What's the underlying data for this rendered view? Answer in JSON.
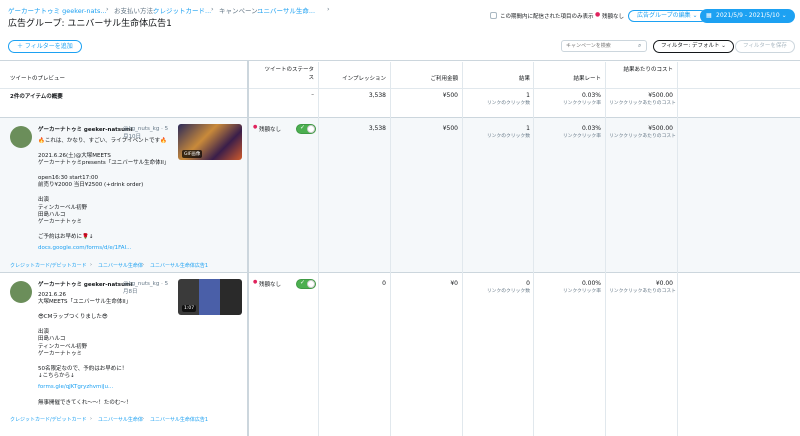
{
  "breadcrumb": {
    "account": "ゲーカーナトゥミ geeker-nats...",
    "payment_label": "お支払い方法:",
    "payment_value": "クレジットカード...",
    "campaign_label": "キャンペーン:",
    "campaign_value": "ユニバーサル生命...",
    "sep": "›"
  },
  "page_title": "広告グループ: ユニバーサル生命体広告1",
  "top_controls": {
    "period_checkbox_label": "この期間内に配信された項目のみ表示",
    "status_label": "残額なし",
    "edit_button": "広告グループの編集 ⌄",
    "date_range": "2021/5/9 - 2021/5/10 ⌄"
  },
  "toolbar": {
    "add_filter": "＋ フィルターを追加",
    "search_placeholder": "キャンペーンを検索",
    "filter_default": "フィルター: デフォルト ⌄",
    "save_filter": "フィルターを保存"
  },
  "columns": {
    "preview": "ツイートのプレビュー",
    "status": "ツイートのステータス",
    "impressions": "インプレッション",
    "spend": "ご利用金額",
    "results": "結果",
    "result_rate": "結果レート",
    "cost_per_result": "結果あたりのコスト"
  },
  "summary": {
    "label": "2件のアイテムの概要",
    "status": "–",
    "impressions": "3,538",
    "spend": "¥500",
    "results": "1",
    "results_sub": "リンクのクリック数",
    "rate": "0.03%",
    "rate_sub": "リンククリック率",
    "cost": "¥500.00",
    "cost_sub": "リンククリックあたりのコスト"
  },
  "rows": [
    {
      "author": "ゲーカーナトゥミ geeker-natsumi",
      "handle": "@kg_nuts_kg · 5月10日",
      "text": "🔥これは、かなり、すごい、ライブイベントです🔥\n\n2021.6.26(土)@大塚MEETS\nゲーカーナトゥミpresents「ユニバーサル生命体II」\n\nopen16:30 start17:00\n前売り¥2000 当日¥2500 (+drink order)\n\n出演\nティンカーベル初野\n田島ハルコ\nゲーカーナトゥミ\n\nご予約はお早めに🌹↓",
      "link": "docs.google.com/forms/d/e/1FAI...",
      "media_badge": "GIF画像",
      "path": [
        "クレジットカード/デビットカード",
        "ユニバーサル生命体",
        "ユニバーサル生命体広告1"
      ],
      "status": "残額なし",
      "impressions": "3,538",
      "spend": "¥500",
      "results": "1",
      "results_sub": "リンクのクリック数",
      "rate": "0.03%",
      "rate_sub": "リンククリック率",
      "cost": "¥500.00",
      "cost_sub": "リンククリックあたりのコスト"
    },
    {
      "author": "ゲーカーナトゥミ geeker-natsumi",
      "handle": "@kg_nuts_kg · 5月8日",
      "text": "2021.6.26\n大塚MEETS「ユニバーサル生命体II」\n\n😎CMラップつくりました😎\n\n出演\n田島ハルコ\nティンカーベル初野\nゲーカーナトゥミ\n\n50名限定なので、予約はお早めに！\n↓こちらから↓",
      "link": "forms.gle/qJKTgryzhvmiJu...",
      "text_after": "\n無事開催できてくれ〜〜！たのむ〜！",
      "media_badge": "1:07",
      "path": [
        "クレジットカード/デビットカード",
        "ユニバーサル生命体",
        "ユニバーサル生命体広告1"
      ],
      "status": "残額なし",
      "impressions": "0",
      "spend": "¥0",
      "results": "0",
      "results_sub": "リンクのクリック数",
      "rate": "0.00%",
      "rate_sub": "リンククリック率",
      "cost": "¥0.00",
      "cost_sub": "リンククリックあたりのコスト"
    }
  ],
  "colors": {
    "accent": "#1da1f2",
    "status_dot": "#e0245e",
    "toggle_on": "#4caf50"
  }
}
